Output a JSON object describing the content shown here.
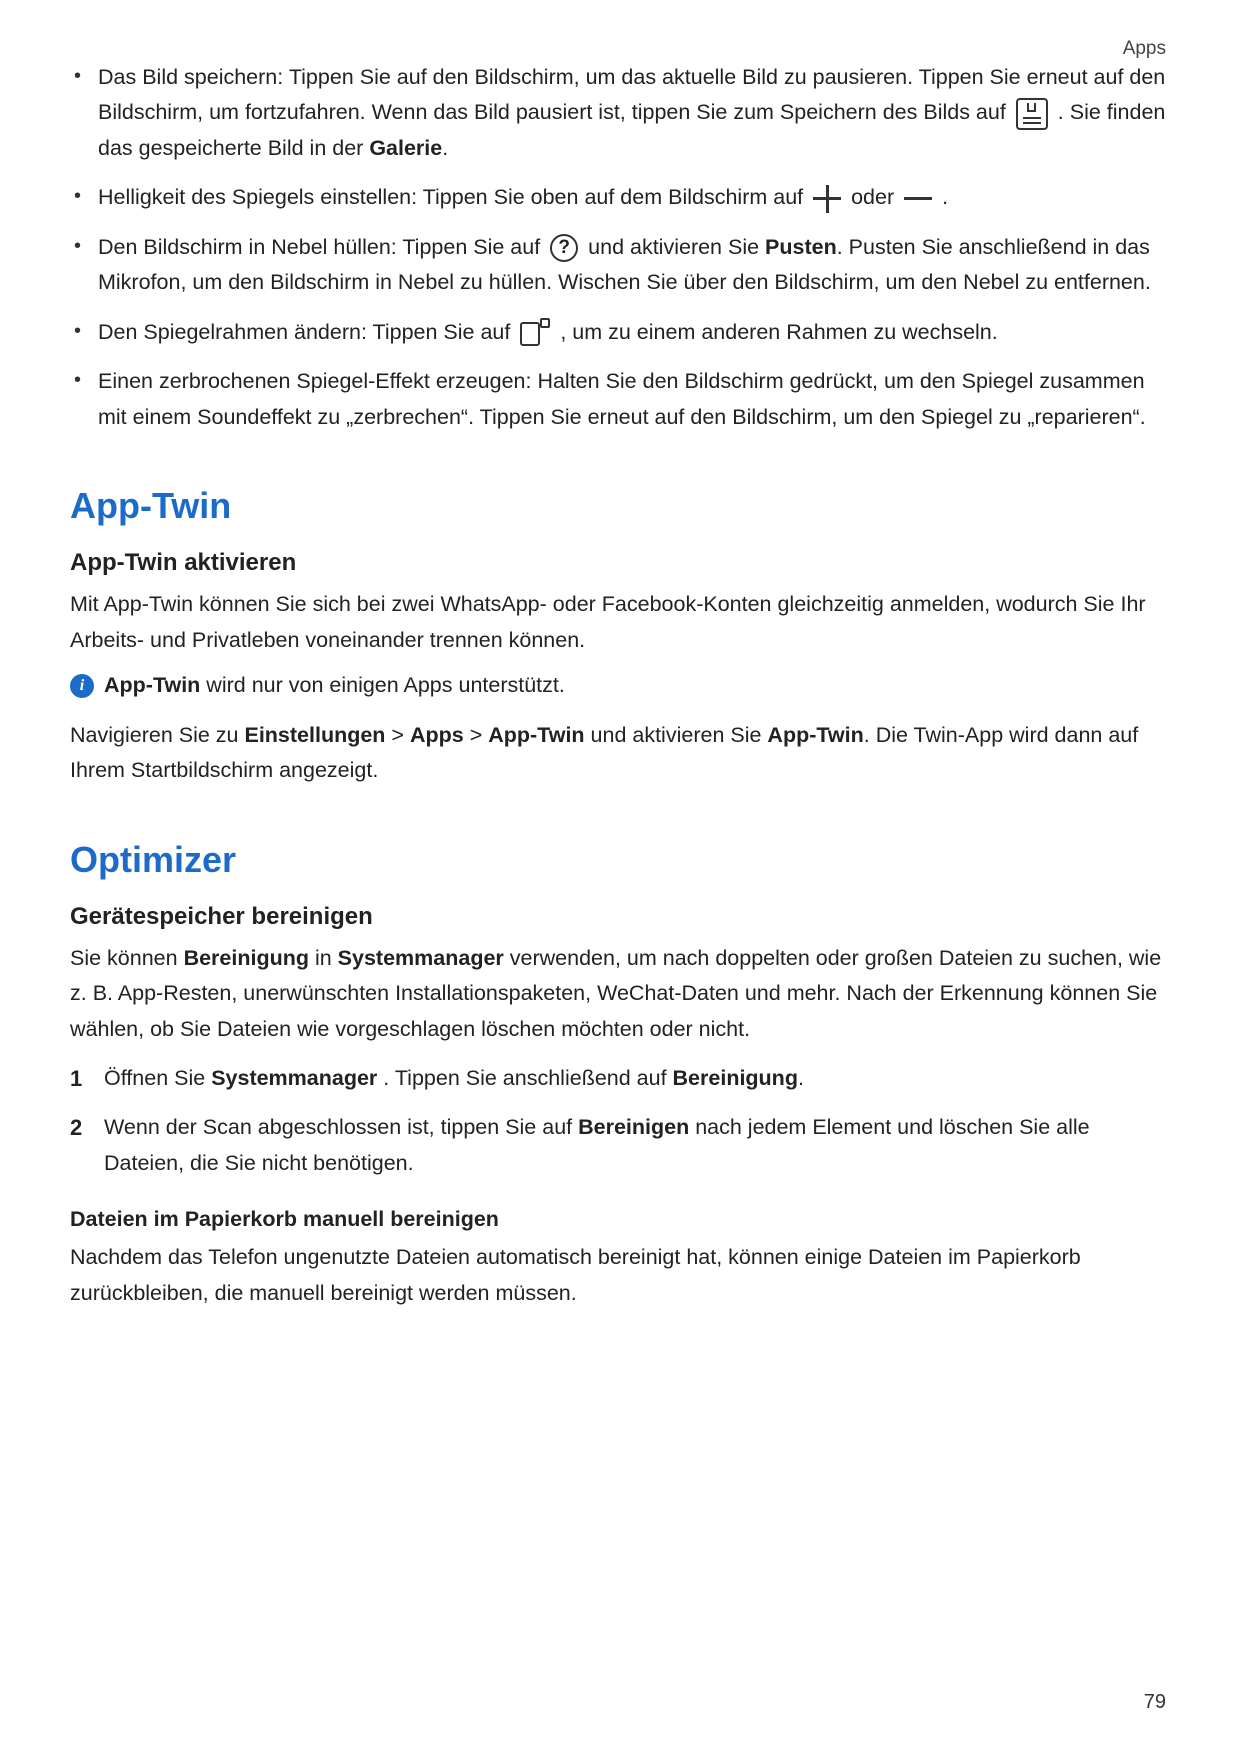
{
  "topLabel": "Apps",
  "bullets": {
    "b1_a": "Das Bild speichern: Tippen Sie auf den Bildschirm, um das aktuelle Bild zu pausieren. Tippen Sie erneut auf den Bildschirm, um fortzufahren. Wenn das Bild pausiert ist, tippen Sie zum Speichern des Bilds auf ",
    "b1_b": " . Sie finden das gespeicherte Bild in der ",
    "b1_gallery": "Galerie",
    "b1_c": ".",
    "b2_a": "Helligkeit des Spiegels einstellen: Tippen Sie oben auf dem Bildschirm auf ",
    "b2_b": " oder ",
    "b2_c": " .",
    "b3_a": "Den Bildschirm in Nebel hüllen: Tippen Sie auf ",
    "b3_b": " und aktivieren Sie ",
    "b3_pusten": "Pusten",
    "b3_c": ". Pusten Sie anschließend in das Mikrofon, um den Bildschirm in Nebel zu hüllen. Wischen Sie über den Bildschirm, um den Nebel zu entfernen.",
    "b4_a": "Den Spiegelrahmen ändern: Tippen Sie auf ",
    "b4_b": " , um zu einem anderen Rahmen zu wechseln.",
    "b5": "Einen zerbrochenen Spiegel-Effekt erzeugen: Halten Sie den Bildschirm gedrückt, um den Spiegel zusammen mit einem Soundeffekt zu „zerbrechen“. Tippen Sie erneut auf den Bildschirm, um den Spiegel zu „reparieren“."
  },
  "appTwin": {
    "title": "App-Twin",
    "sub": "App-Twin aktivieren",
    "p1": "Mit App-Twin können Sie sich bei zwei WhatsApp- oder Facebook-Konten gleichzeitig anmelden, wodurch Sie Ihr Arbeits- und Privatleben voneinander trennen können.",
    "info_bold": "App-Twin",
    "info_rest": " wird nur von einigen Apps unterstützt.",
    "nav_a": "Navigieren Sie zu ",
    "nav_settings": "Einstellungen",
    "nav_gt1": " > ",
    "nav_apps": "Apps",
    "nav_gt2": " > ",
    "nav_twin": "App-Twin",
    "nav_b": " und aktivieren Sie ",
    "nav_twin2": "App-Twin",
    "nav_c": ". Die Twin-App wird dann auf Ihrem Startbildschirm angezeigt."
  },
  "optimizer": {
    "title": "Optimizer",
    "sub": "Gerätespeicher bereinigen",
    "p_a": "Sie können ",
    "p_clean": "Bereinigung",
    "p_b": " in ",
    "p_sys": "Systemmanager",
    "p_c": " verwenden, um nach doppelten oder großen Dateien zu suchen, wie z. B. App-Resten, unerwünschten Installationspaketen, WeChat-Daten und mehr. Nach der Erkennung können Sie wählen, ob Sie Dateien wie vorgeschlagen löschen möchten oder nicht.",
    "s1_a": "Öffnen Sie ",
    "s1_sys": "Systemmanager",
    "s1_b": " . Tippen Sie anschließend auf ",
    "s1_clean": "Bereinigung",
    "s1_c": ".",
    "s2_a": "Wenn der Scan abgeschlossen ist, tippen Sie auf ",
    "s2_clean": "Bereinigen",
    "s2_b": " nach jedem Element und löschen Sie alle Dateien, die Sie nicht benötigen.",
    "subsub": "Dateien im Papierkorb manuell bereinigen",
    "p2": "Nachdem das Telefon ungenutzte Dateien automatisch bereinigt hat, können einige Dateien im Papierkorb zurückbleiben, die manuell bereinigt werden müssen."
  },
  "pageNumber": "79",
  "infoGlyph": "i"
}
